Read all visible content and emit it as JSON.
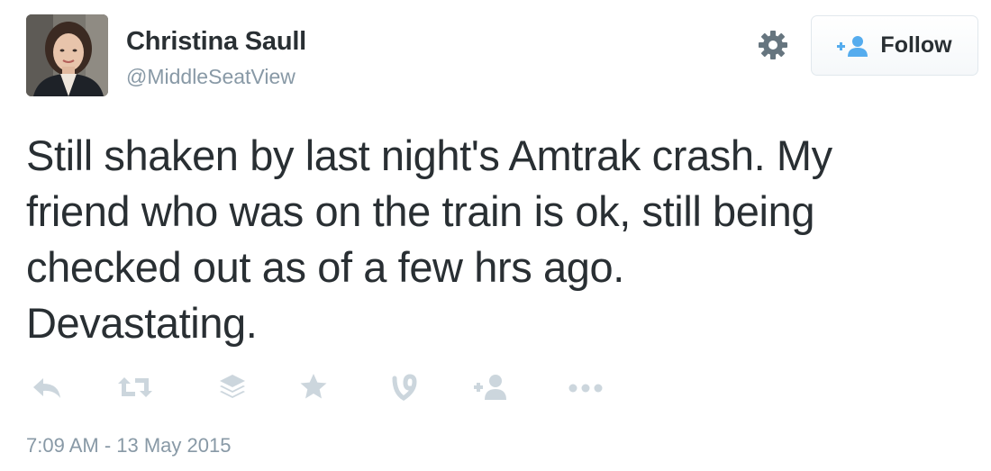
{
  "user": {
    "display_name": "Christina Saull",
    "handle": "@MiddleSeatView",
    "avatar": "profile-photo"
  },
  "follow_button": {
    "label": "Follow",
    "icon": "follow-user-icon"
  },
  "settings_icon": "gear-icon",
  "tweet": {
    "text": "Still shaken by last night's Amtrak crash. My\nfriend who was on the train is ok, still being\nchecked out as of a few hrs ago.\nDevastating.",
    "timestamp": "7:09 AM - 13 May 2015"
  },
  "actions": [
    {
      "name": "reply",
      "icon": "reply-icon"
    },
    {
      "name": "retweet",
      "icon": "retweet-icon"
    },
    {
      "name": "buffer",
      "icon": "buffer-icon"
    },
    {
      "name": "favorite",
      "icon": "star-icon"
    },
    {
      "name": "vine",
      "icon": "vine-icon"
    },
    {
      "name": "follow",
      "icon": "follow-user-icon"
    },
    {
      "name": "more",
      "icon": "more-icon"
    }
  ],
  "colors": {
    "text": "#292f33",
    "muted": "#8899a6",
    "action_icon": "#ccd6dd",
    "follow_icon": "#55acee",
    "border": "#e1e8ed"
  }
}
